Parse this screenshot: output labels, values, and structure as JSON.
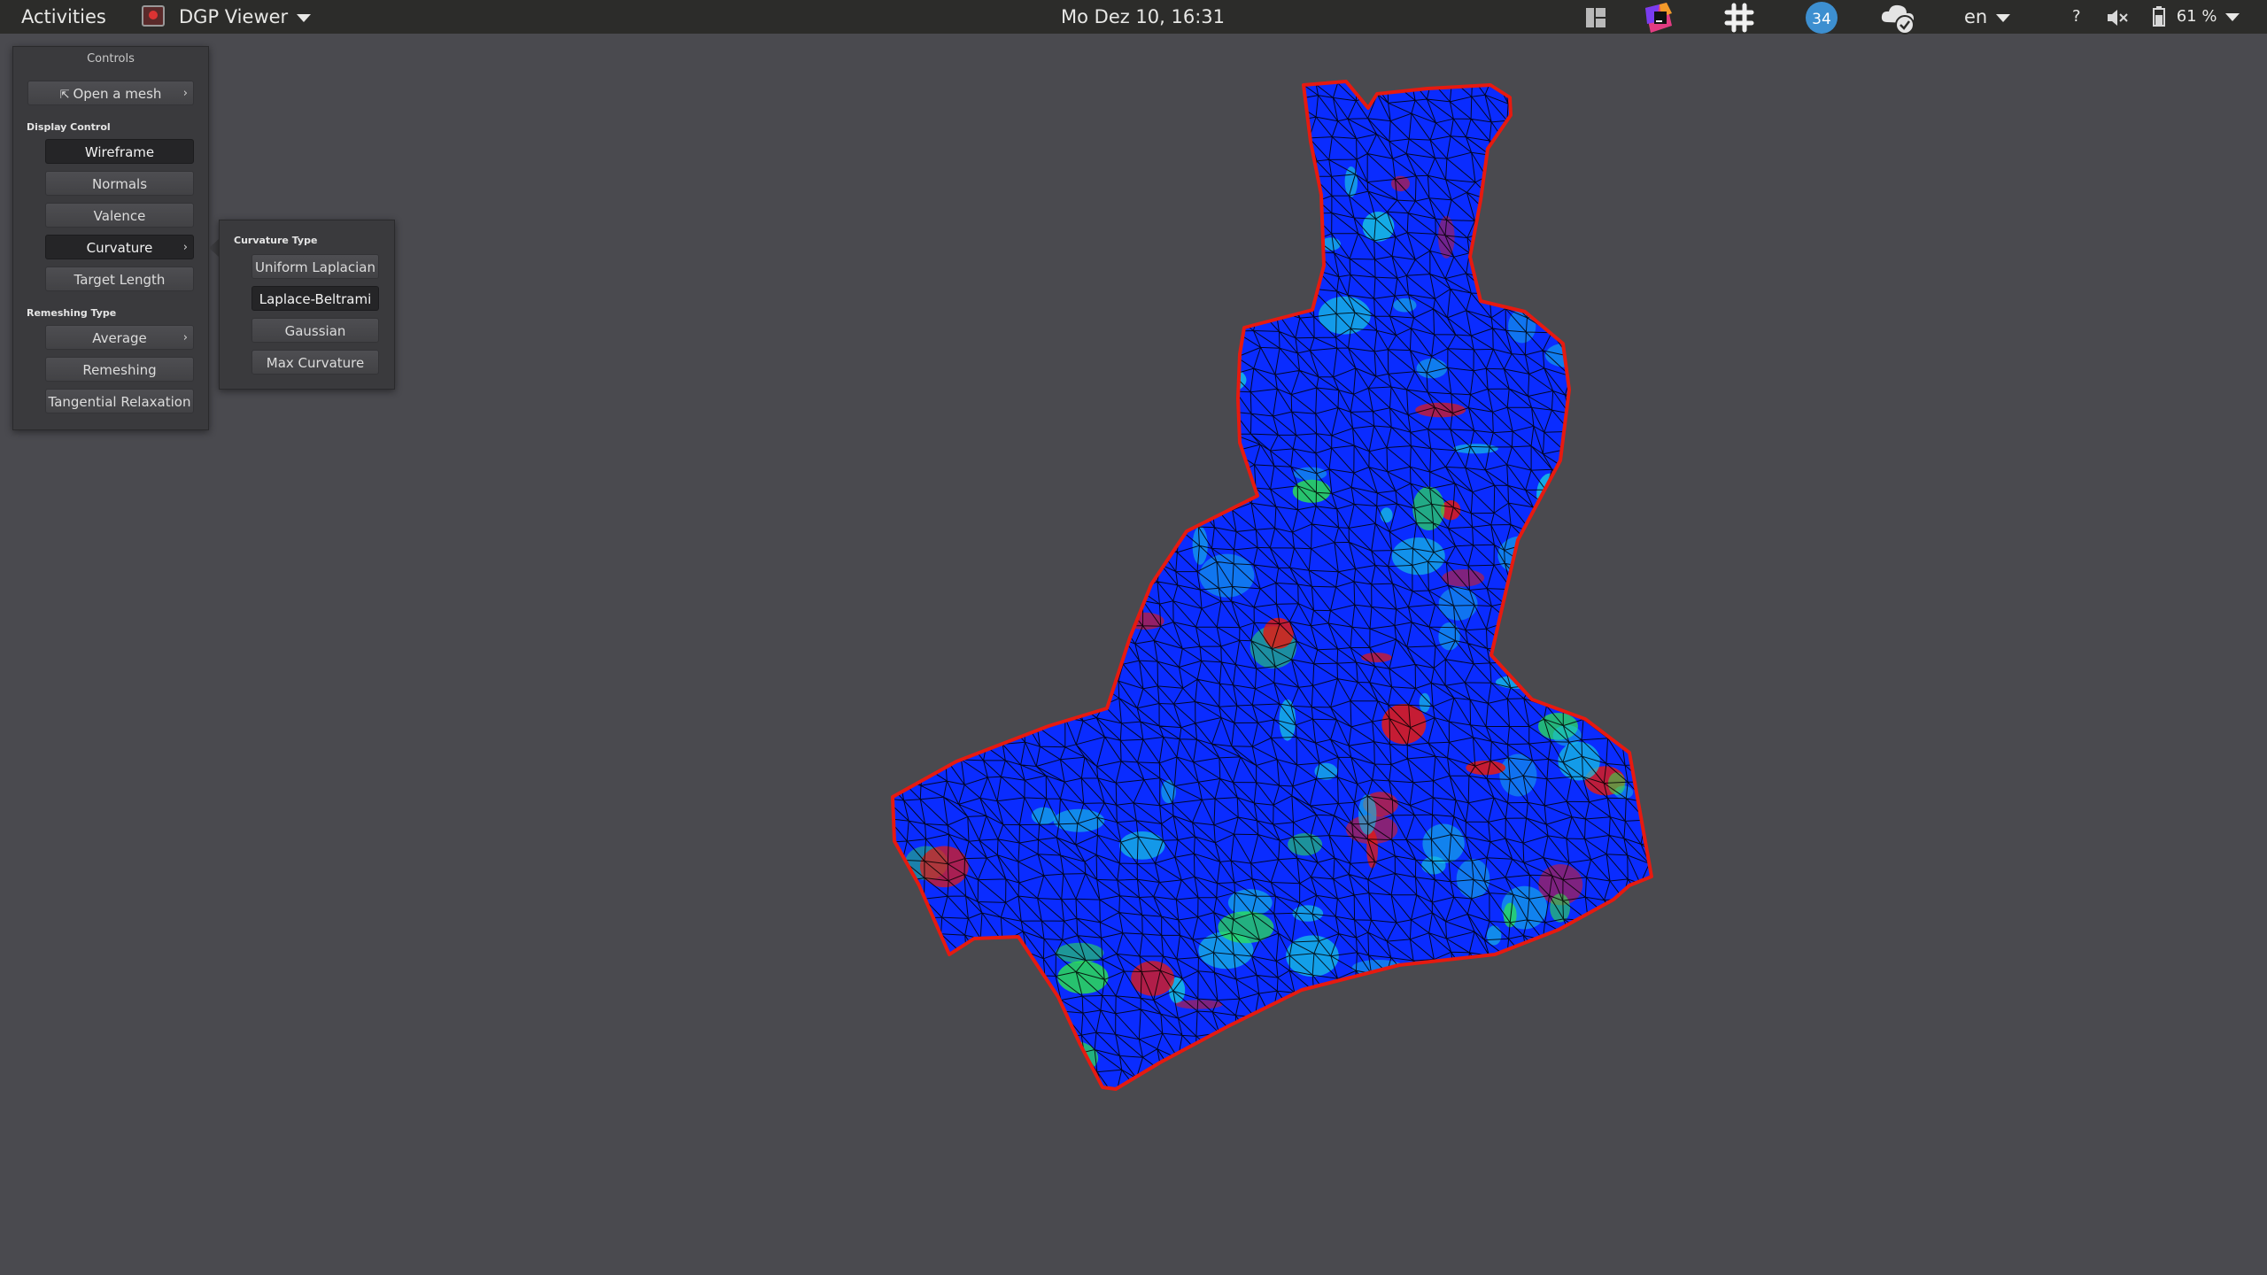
{
  "topbar": {
    "activities": "Activities",
    "app_name": "DGP Viewer",
    "clock": "Mo Dez 10, 16:31",
    "notification_count": "34",
    "language": "en",
    "help": "?",
    "battery": "61 %"
  },
  "controls": {
    "title": "Controls",
    "open_mesh": "Open a mesh",
    "display_control_label": "Display Control",
    "wireframe": "Wireframe",
    "normals": "Normals",
    "valence": "Valence",
    "curvature": "Curvature",
    "target_length": "Target Length",
    "remeshing_type_label": "Remeshing Type",
    "average": "Average",
    "remeshing": "Remeshing",
    "tangential_relaxation": "Tangential Relaxation"
  },
  "curvature_popup": {
    "title": "Curvature Type",
    "options": [
      "Uniform Laplacian",
      "Laplace-Beltrami",
      "Gaussian",
      "Max Curvature"
    ],
    "selected": "Laplace-Beltrami"
  },
  "colors": {
    "background": "#4a4a4f",
    "wire": "#000000",
    "curvature_low": "#0a2cff",
    "curvature_mid": "#17c6e0",
    "curvature_high": "#2ee84a",
    "curvature_peak": "#e61a10"
  }
}
